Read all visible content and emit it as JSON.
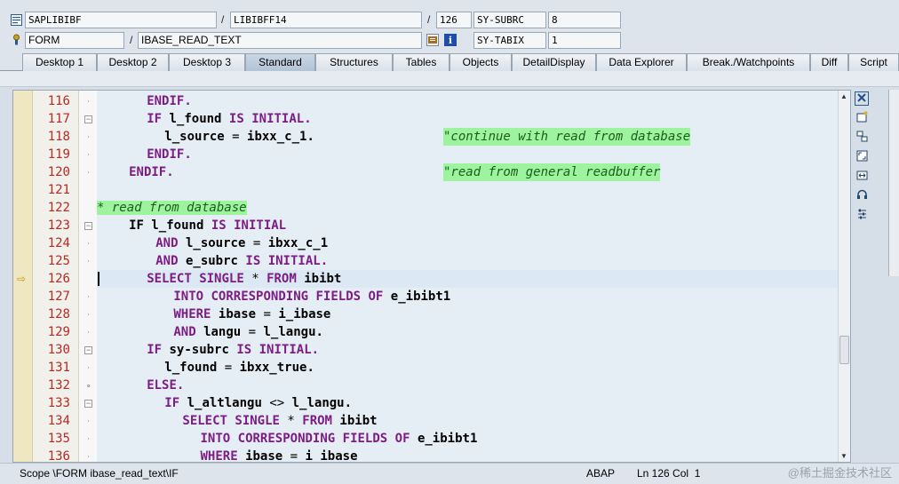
{
  "header": {
    "program": "SAPLIBIBF",
    "include": "LIBIBFF14",
    "line_no": "126",
    "var1_name": "SY-SUBRC",
    "var1_value": "8",
    "event_type": "FORM",
    "event_name": "IBASE_READ_TEXT",
    "var2_name": "SY-TABIX",
    "var2_value": "1",
    "slash": "/"
  },
  "tabs": [
    {
      "label": "Desktop 1"
    },
    {
      "label": "Desktop 2"
    },
    {
      "label": "Desktop 3"
    },
    {
      "label": "Standard"
    },
    {
      "label": "Structures"
    },
    {
      "label": "Tables"
    },
    {
      "label": "Objects"
    },
    {
      "label": "DetailDisplay"
    },
    {
      "label": "Data Explorer"
    },
    {
      "label": "Break./Watchpoints"
    },
    {
      "label": "Diff"
    },
    {
      "label": "Script"
    }
  ],
  "active_tab": "Standard",
  "lines": [
    {
      "num": "116",
      "indent": 4,
      "segs": [
        [
          "kw",
          "ENDIF."
        ]
      ]
    },
    {
      "num": "117",
      "indent": 4,
      "segs": [
        [
          "kw",
          "IF "
        ],
        [
          "nm",
          "l_found "
        ],
        [
          "kw",
          "IS INITIAL."
        ]
      ]
    },
    {
      "num": "118",
      "indent": 6,
      "segs": [
        [
          "nm",
          "l_source "
        ],
        [
          "ps",
          "= "
        ],
        [
          "nm",
          "ibxx_c_1."
        ]
      ],
      "comment": "\"continue with read from database"
    },
    {
      "num": "119",
      "indent": 4,
      "segs": [
        [
          "kw",
          "ENDIF."
        ]
      ]
    },
    {
      "num": "120",
      "indent": 2,
      "segs": [
        [
          "kw",
          "ENDIF."
        ]
      ],
      "comment": "\"read from general readbuffer"
    },
    {
      "num": "121",
      "indent": 0,
      "segs": []
    },
    {
      "num": "122",
      "indent": 0,
      "segs": [],
      "fullcomment": "* read from database"
    },
    {
      "num": "123",
      "indent": 2,
      "segs": [
        [
          "nm",
          "IF l_found "
        ],
        [
          "kw",
          "IS INITIAL"
        ]
      ]
    },
    {
      "num": "124",
      "indent": 5,
      "segs": [
        [
          "kw",
          "AND "
        ],
        [
          "nm",
          "l_source "
        ],
        [
          "ps",
          "= "
        ],
        [
          "nm",
          "ibxx_c_1"
        ]
      ]
    },
    {
      "num": "125",
      "indent": 5,
      "segs": [
        [
          "kw",
          "AND "
        ],
        [
          "nm",
          "e_subrc "
        ],
        [
          "kw",
          "IS INITIAL."
        ]
      ]
    },
    {
      "num": "126",
      "indent": 4,
      "segs": [
        [
          "kw",
          "SELECT SINGLE "
        ],
        [
          "ps",
          "* "
        ],
        [
          "kw",
          "FROM "
        ],
        [
          "nm",
          "ibibt"
        ]
      ]
    },
    {
      "num": "127",
      "indent": 7,
      "segs": [
        [
          "kw",
          "INTO CORRESPONDING FIELDS OF "
        ],
        [
          "nm",
          "e_ibibt1"
        ]
      ]
    },
    {
      "num": "128",
      "indent": 7,
      "segs": [
        [
          "kw",
          "WHERE "
        ],
        [
          "nm",
          "ibase "
        ],
        [
          "ps",
          "= "
        ],
        [
          "nm",
          "i_ibase"
        ]
      ]
    },
    {
      "num": "129",
      "indent": 7,
      "segs": [
        [
          "kw",
          "AND "
        ],
        [
          "nm",
          "langu "
        ],
        [
          "ps",
          "= "
        ],
        [
          "nm",
          "l_langu."
        ]
      ]
    },
    {
      "num": "130",
      "indent": 4,
      "segs": [
        [
          "kw",
          "IF "
        ],
        [
          "nm",
          "sy-subrc "
        ],
        [
          "kw",
          "IS INITIAL."
        ]
      ]
    },
    {
      "num": "131",
      "indent": 6,
      "segs": [
        [
          "nm",
          "l_found "
        ],
        [
          "ps",
          "= "
        ],
        [
          "nm",
          "ibxx_true."
        ]
      ]
    },
    {
      "num": "132",
      "indent": 4,
      "segs": [
        [
          "kw",
          "ELSE."
        ]
      ]
    },
    {
      "num": "133",
      "indent": 6,
      "segs": [
        [
          "kw",
          "IF "
        ],
        [
          "nm",
          "l_altlangu "
        ],
        [
          "ps",
          "<> "
        ],
        [
          "nm",
          "l_langu."
        ]
      ]
    },
    {
      "num": "134",
      "indent": 8,
      "segs": [
        [
          "kw",
          "SELECT SINGLE "
        ],
        [
          "ps",
          "* "
        ],
        [
          "kw",
          "FROM "
        ],
        [
          "nm",
          "ibibt"
        ]
      ]
    },
    {
      "num": "135",
      "indent": 10,
      "segs": [
        [
          "kw",
          "INTO CORRESPONDING FIELDS OF "
        ],
        [
          "nm",
          "e_ibibt1"
        ]
      ]
    },
    {
      "num": "136",
      "indent": 10,
      "segs": [
        [
          "kw",
          "WHERE "
        ],
        [
          "nm",
          "ibase "
        ],
        [
          "ps",
          "= "
        ],
        [
          "nm",
          "i ibase"
        ]
      ]
    }
  ],
  "current_line": "126",
  "status": {
    "scope": "Scope \\FORM ibase_read_text\\IF",
    "language": "ABAP",
    "position": "Ln 126 Col  1",
    "watermark": "@稀土掘金技术社区"
  },
  "icons": {
    "program": "program-icon",
    "event": "event-icon",
    "source": "source-display-icon",
    "info": "info-icon",
    "tools": [
      "close-icon",
      "new-window-icon",
      "swap-icon",
      "fullscreen-icon",
      "expand-horizontal-icon",
      "headset-icon",
      "settings-icon"
    ]
  },
  "colors": {
    "keyword": "#7b1d84",
    "line_number": "#b42a24",
    "comment_bg": "#9ef39e",
    "breakpoint_arrow": "#c49a00"
  }
}
